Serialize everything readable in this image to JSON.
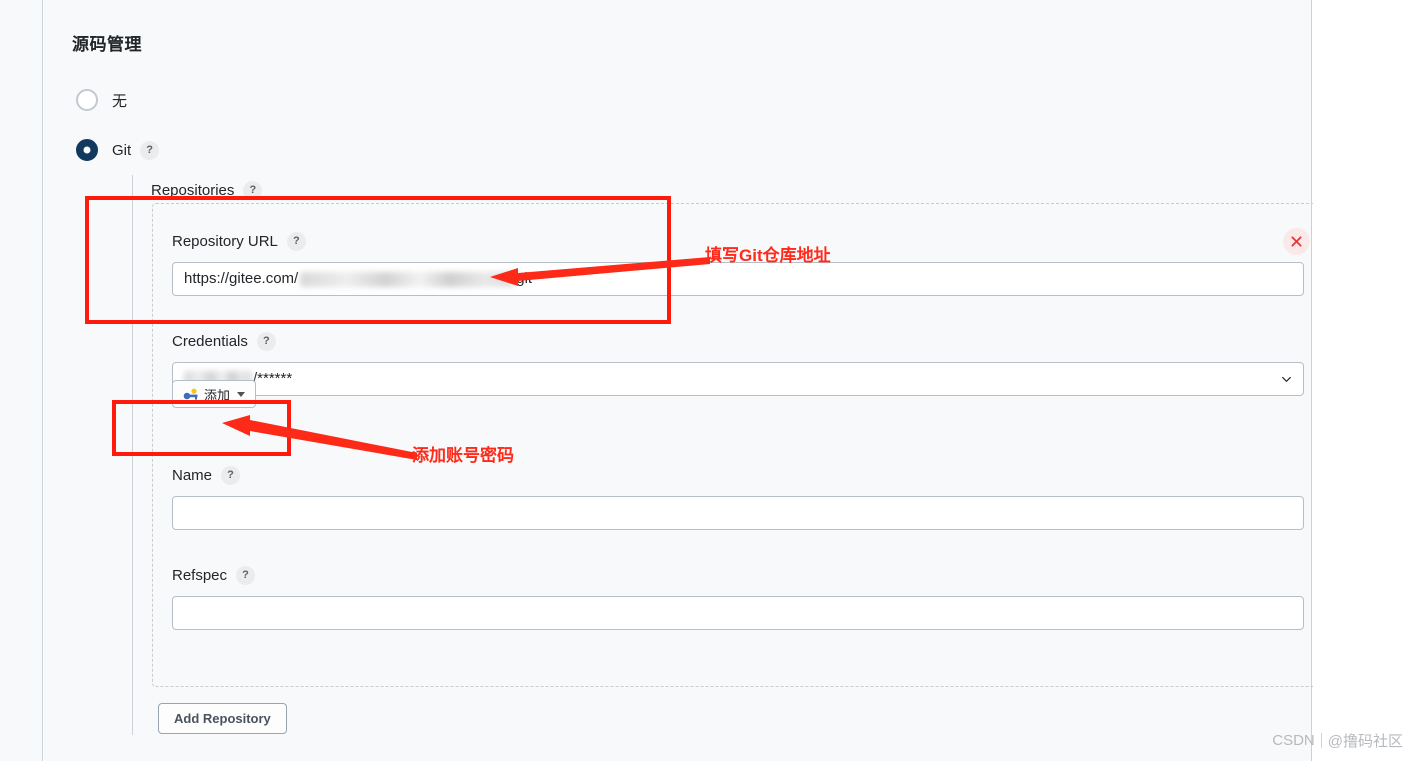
{
  "section": {
    "title": "源码管理"
  },
  "scm_options": [
    {
      "label": "无",
      "selected": false,
      "has_help": false
    },
    {
      "label": "Git",
      "selected": true,
      "has_help": true
    }
  ],
  "git": {
    "repositories_label": "Repositories",
    "repository": {
      "url": {
        "label": "Repository URL",
        "value_prefix": "https://gitee.com/",
        "value_suffix": "git",
        "redacted": true
      },
      "credentials": {
        "label": "Credentials",
        "value_suffix": "/******",
        "redacted": true
      },
      "add_credentials_button": "添加",
      "name": {
        "label": "Name",
        "value": ""
      },
      "refspec": {
        "label": "Refspec",
        "value": ""
      }
    },
    "add_repository_button": "Add Repository",
    "remove_repository_icon": "close-icon"
  },
  "annotations": [
    {
      "text": "填写Git仓库地址",
      "color": "#ff2a1a"
    },
    {
      "text": "添加账号密码",
      "color": "#ff2a1a"
    }
  ],
  "help_icon_glyph": "?",
  "watermark": {
    "brand": "CSDN",
    "author": "@撸码社区"
  },
  "colors": {
    "accent_radio": "#123a5e",
    "annotation_red": "#ff1a0d",
    "panel_bg": "#f8f9fa",
    "input_border": "#b6bfc7"
  }
}
